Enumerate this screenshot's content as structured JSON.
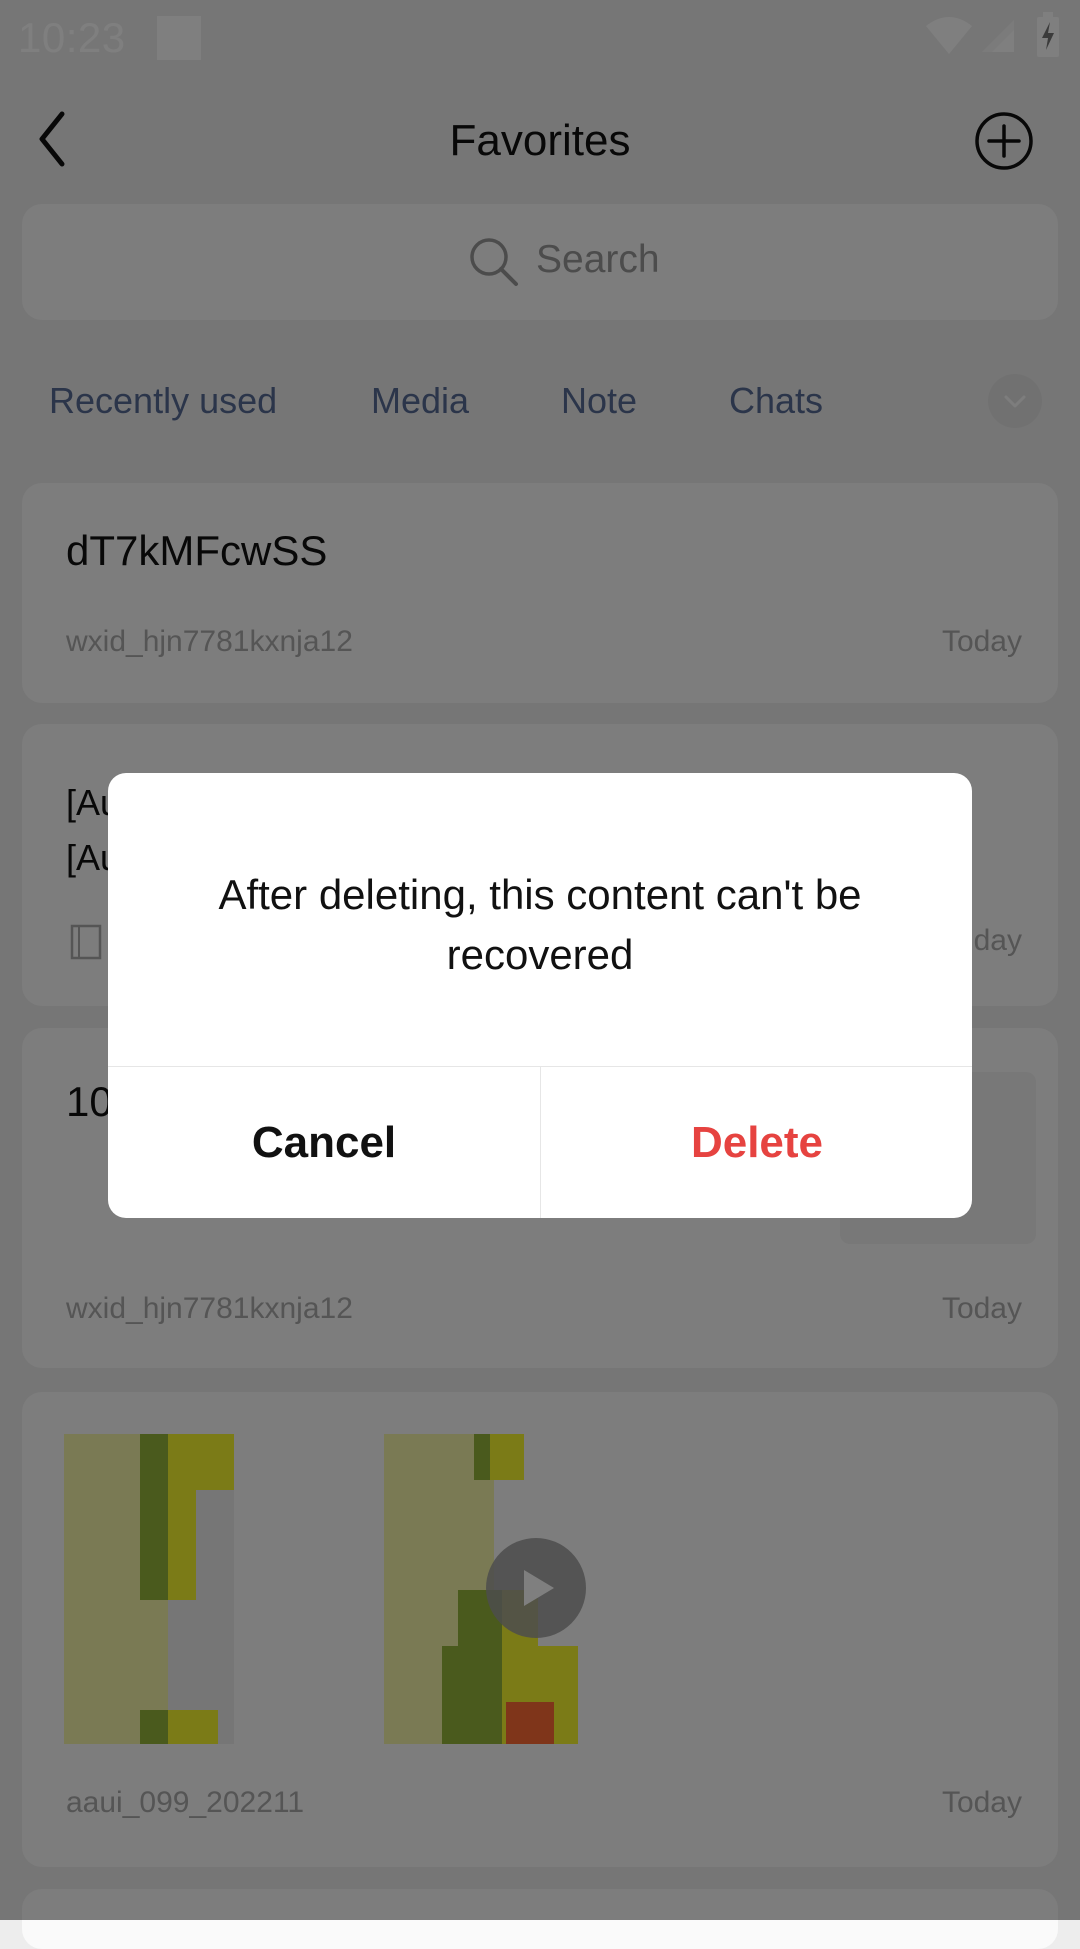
{
  "status_bar": {
    "time": "10:23"
  },
  "header": {
    "title": "Favorites"
  },
  "search": {
    "placeholder": "Search"
  },
  "tabs": [
    "Recently used",
    "Media",
    "Note",
    "Chats"
  ],
  "cards": [
    {
      "title": "dT7kMFcwSS",
      "meta": "wxid_hjn7781kxnja12",
      "date": "Today"
    },
    {
      "line1": "[Au",
      "line2": "[Au",
      "date": "day"
    },
    {
      "title": "10",
      "meta": "wxid_hjn7781kxnja12",
      "date": "Today"
    },
    {
      "meta": "aaui_099_202211",
      "date": "Today"
    }
  ],
  "dialog": {
    "message": "After deleting, this content can't be recovered",
    "cancel": "Cancel",
    "delete": "Delete"
  },
  "colors": {
    "link": "#576b95",
    "danger": "#e64340"
  }
}
